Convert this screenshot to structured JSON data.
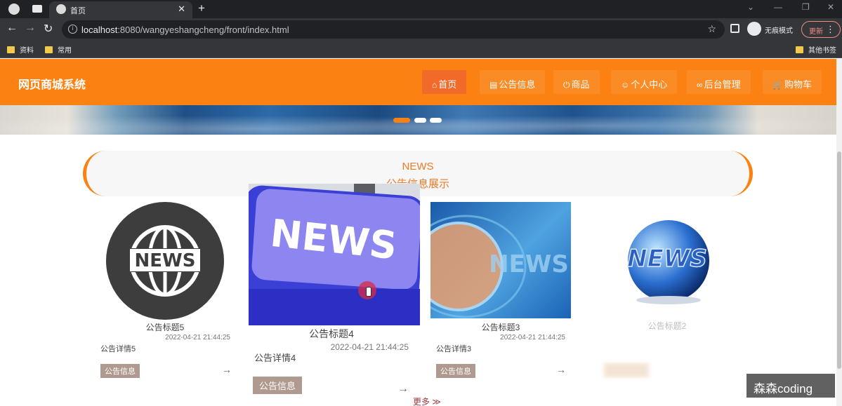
{
  "browser": {
    "tab_title": "首页",
    "url_host": "localhost",
    "url_rest": ":8080/wangyeshangcheng/front/index.html",
    "incognito_label": "无痕模式",
    "update_label": "更新",
    "bookmarks": [
      "资料",
      "常用"
    ],
    "other_bookmarks": "其他书签"
  },
  "site": {
    "title": "网页商城系统",
    "nav": [
      {
        "label": "首页",
        "icon": "home-icon"
      },
      {
        "label": "公告信息",
        "icon": "notice-icon"
      },
      {
        "label": "商品",
        "icon": "power-icon"
      },
      {
        "label": "个人中心",
        "icon": "user-icon"
      },
      {
        "label": "后台管理",
        "icon": "link-icon"
      },
      {
        "label": "购物车",
        "icon": "cart-icon"
      }
    ],
    "accent_color": "#fb8212"
  },
  "news": {
    "heading_en": "NEWS",
    "heading_cn": "公告信息展示",
    "cards": [
      {
        "title": "公告标题5",
        "time": "2022-04-21 21:44:25",
        "detail": "公告详情5",
        "badge": "公告信息"
      },
      {
        "title": "公告标题4",
        "time": "2022-04-21 21:44:25",
        "detail": "公告详情4",
        "badge": "公告信息"
      },
      {
        "title": "公告标题3",
        "time": "2022-04-21 21:44:25",
        "detail": "公告详情3",
        "badge": "公告信息"
      },
      {
        "title": "公告标题2"
      }
    ],
    "image_text": "NEWS",
    "more_label": "更多 ≫"
  },
  "watermark": "森森coding"
}
